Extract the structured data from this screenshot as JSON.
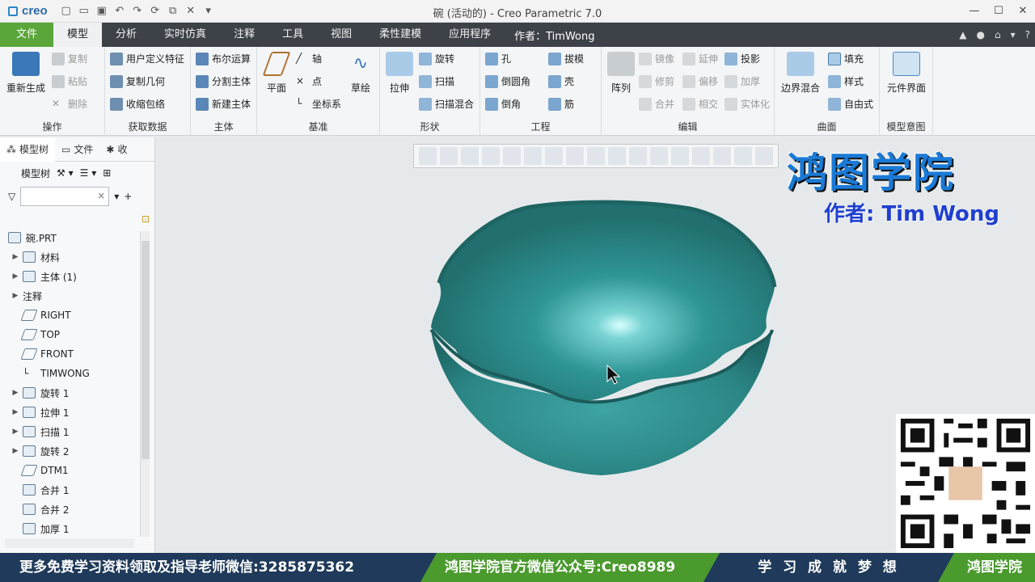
{
  "app": {
    "logo_text": "creo",
    "window_title": "碗 (活动的) - Creo Parametric 7.0"
  },
  "tabs": [
    {
      "label": "文件"
    },
    {
      "label": "模型"
    },
    {
      "label": "分析"
    },
    {
      "label": "实时仿真"
    },
    {
      "label": "注释"
    },
    {
      "label": "工具"
    },
    {
      "label": "视图"
    },
    {
      "label": "柔性建模"
    },
    {
      "label": "应用程序"
    }
  ],
  "tab_author": "作者：TimWong",
  "ribbon": {
    "operations": {
      "label": "操作",
      "regen": "重新生成",
      "copy": "复制",
      "paste": "粘贴",
      "delete": "删除"
    },
    "get_data": {
      "label": "获取数据",
      "udf": "用户定义特征",
      "copy_geom": "复制几何",
      "shrinkwrap": "收缩包络"
    },
    "body": {
      "label": "主体",
      "boolean": "布尔运算",
      "split": "分割主体",
      "new_body": "新建主体"
    },
    "datum": {
      "label": "基准",
      "plane": "平面",
      "axis": "轴",
      "point": "点",
      "csys": "坐标系",
      "sketch": "草绘"
    },
    "shapes": {
      "label": "形状",
      "extrude": "拉伸",
      "revolve": "旋转",
      "sweep": "扫描",
      "swept_blend": "扫描混合"
    },
    "engineering": {
      "label": "工程",
      "hole": "孔",
      "round": "倒圆角",
      "chamfer": "倒角",
      "draft": "拔模",
      "shell": "壳",
      "rib": "筋"
    },
    "editing": {
      "label": "编辑",
      "pattern": "阵列",
      "mirror": "镜像",
      "extend": "延伸",
      "project": "投影",
      "trim": "修剪",
      "offset": "偏移",
      "thicken": "加厚",
      "merge": "合并",
      "intersect": "相交",
      "solidify": "实体化"
    },
    "surfaces": {
      "label": "曲面",
      "boundary_blend": "边界混合",
      "fill": "填充",
      "style": "样式",
      "freestyle": "自由式"
    },
    "model_intent": {
      "label": "模型意图",
      "component_interface": "元件界面"
    }
  },
  "panel": {
    "tabs": [
      {
        "label": "模型树"
      },
      {
        "label": "文件"
      },
      {
        "label": "收"
      }
    ],
    "toolbar_label": "模型树",
    "filter_placeholder": "",
    "tree": [
      {
        "label": "碗.PRT",
        "expand": ""
      },
      {
        "label": "材料",
        "expand": "▶"
      },
      {
        "label": "主体 (1)",
        "expand": "▶"
      },
      {
        "label": "注释",
        "expand": "▶"
      },
      {
        "label": "RIGHT",
        "expand": ""
      },
      {
        "label": "TOP",
        "expand": ""
      },
      {
        "label": "FRONT",
        "expand": ""
      },
      {
        "label": "TIMWONG",
        "expand": ""
      },
      {
        "label": "旋转 1",
        "expand": "▶"
      },
      {
        "label": "拉伸 1",
        "expand": "▶"
      },
      {
        "label": "扫描 1",
        "expand": "▶"
      },
      {
        "label": "旋转 2",
        "expand": "▶"
      },
      {
        "label": "DTM1",
        "expand": ""
      },
      {
        "label": "合并 1",
        "expand": ""
      },
      {
        "label": "合并 2",
        "expand": ""
      },
      {
        "label": "加厚 1",
        "expand": ""
      }
    ]
  },
  "overlay": {
    "brand_name": "鸿图学院",
    "brand_author": "作者: Tim Wong"
  },
  "bottom_bar": {
    "text1": "更多免费学习资料领取及指导老师微信:3285875362",
    "text2": "鸿图学院官方微信公众号:Creo8989",
    "text3": "学 习 成 就 梦 想",
    "text4": "鸿图学院"
  },
  "colors": {
    "accent": "#5aa63a",
    "model": "#2a8a8a",
    "tabbar": "#3c4248"
  }
}
